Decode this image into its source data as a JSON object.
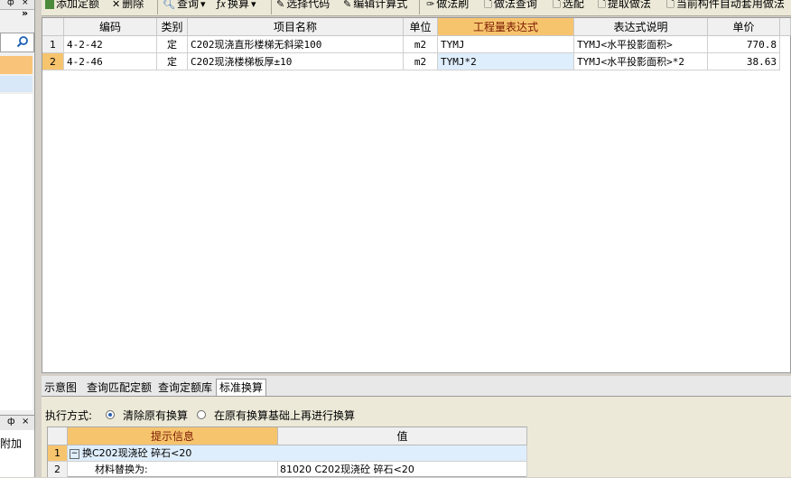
{
  "left_panel": {
    "pin_glyph": "ф",
    "close_glyph": "×",
    "chevron": "»",
    "bottom_pin": "ф",
    "bottom_close": "×",
    "bottom_label": "附加"
  },
  "toolbar": {
    "add_quota": "添加定额",
    "delete": "删除",
    "query": "查询",
    "convert": "换算",
    "select_code": "选择代码",
    "edit_formula": "编辑计算式",
    "method_brush": "做法刷",
    "method_query": "做法查询",
    "select_match": "选配",
    "extract_method": "提取做法",
    "auto_apply": "当前构件自动套用做法"
  },
  "grid": {
    "headers": [
      "编码",
      "类别",
      "项目名称",
      "单位",
      "工程量表达式",
      "表达式说明",
      "单价"
    ],
    "rows": [
      {
        "num": "1",
        "code": "4-2-42",
        "type": "定",
        "name": "C202现浇直形楼梯无斜梁100",
        "unit": "m2",
        "expr": "TYMJ",
        "desc": "TYMJ<水平投影面积>",
        "price": "770.8"
      },
      {
        "num": "2",
        "code": "4-2-46",
        "type": "定",
        "name": "C202现浇楼梯板厚±10",
        "unit": "m2",
        "expr": "TYMJ*2",
        "desc": "TYMJ<水平投影面积>*2",
        "price": "38.63"
      }
    ]
  },
  "tabs": [
    "示意图",
    "查询匹配定额",
    "查询定额库",
    "标准换算"
  ],
  "bottom": {
    "exec_label": "执行方式:",
    "option1": "清除原有换算",
    "option2": "在原有换算基础上再进行换算",
    "headers": [
      "提示信息",
      "值"
    ],
    "rows": [
      {
        "num": "1",
        "info": "换C202现浇砼 碎石<20",
        "value": ""
      },
      {
        "num": "2",
        "info": "材料替换为:",
        "value": "81020  C202现浇砼 碎石<20"
      }
    ]
  },
  "colors": {
    "header_highlight": "#f7c46e",
    "selected_cell": "#dfeefc",
    "toolbar_bg": "#ece9d8"
  }
}
